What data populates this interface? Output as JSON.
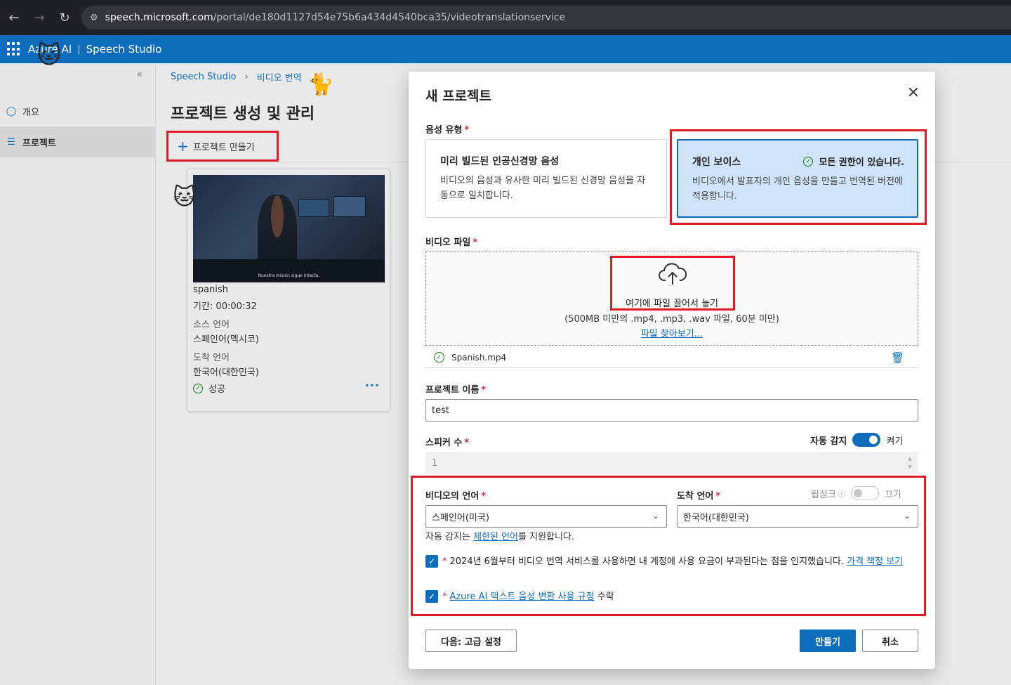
{
  "browser": {
    "url_host": "speech.microsoft.com",
    "url_path": "/portal/de180d1127d54e75b6a434d4540bca35/videotranslationservice"
  },
  "header": {
    "brand": "Azure AI",
    "studio": "Speech Studio"
  },
  "sidebar": {
    "items": [
      {
        "label": "개요",
        "icon": "lightbulb-icon"
      },
      {
        "label": "프로젝트",
        "icon": "list-icon"
      }
    ]
  },
  "main": {
    "breadcrumb": [
      "Speech Studio",
      "비디오 번역"
    ],
    "title": "프로젝트 생성 및 관리",
    "create_label": "프로젝트 만들기",
    "card": {
      "video_caption": "Nuestra misión sigue intacta.",
      "name": "spanish",
      "duration": "기간: 00:00:32",
      "source_label": "소스 언어",
      "source_value": "스페인어(멕시코)",
      "target_label": "도착 언어",
      "target_value": "한국어(대한민국)",
      "status": "성공"
    }
  },
  "modal": {
    "title": "새 프로젝트",
    "voice_type_label": "음성 유형",
    "voice_options": [
      {
        "title": "미리 빌드된 인공신경망 음성",
        "desc": "비디오의 음성과 유사한 미리 빌드된 신경망 음성을 자동으로 일치합니다."
      },
      {
        "title": "개인 보이스",
        "desc": "비디오에서 발표자의 개인 음성을 만들고 번역된 버전에 적용합니다.",
        "badge": "모든 권한이 있습니다."
      }
    ],
    "video_file_label": "비디오 파일",
    "drop_text": "여기에 파일 끌어서 놓기",
    "drop_sub": "(500MB 미만의 .mp4, .mp3, .wav 파일, 60분 미만)",
    "browse": "파일 찾아보기...",
    "file_name": "Spanish.mp4",
    "project_name_label": "프로젝트 이름",
    "project_name_value": "test",
    "speaker_label": "스피커 수",
    "auto_detect_label": "자동 감지",
    "auto_detect_state": "켜기",
    "speaker_value": "1",
    "video_lang_label": "비디오의 언어",
    "video_lang_value": "스페인어(미국)",
    "target_lang_label": "도착 언어",
    "lipsync_label": "립싱크",
    "lipsync_state": "끄기",
    "target_lang_value": "한국어(대한민국)",
    "note_prefix": "자동 감지는 ",
    "note_link": "제한된 언어",
    "note_suffix": "를 지원합니다.",
    "consent_text": "2024년 6월부터 비디오 번역 서비스를 사용하면 내 계정에 사용 요금이 부과된다는 점을 인지했습니다. ",
    "consent_link": "가격 책정 보기",
    "terms_link": "Azure AI 텍스트 음성 변환 사용 규정",
    "terms_suffix": " 수락",
    "btn_next": "다음: 고급 설정",
    "btn_create": "만들기",
    "btn_cancel": "취소"
  },
  "colors": {
    "accent": "#0f6cbd",
    "highlight": "#e01b24",
    "success": "#107c10"
  }
}
